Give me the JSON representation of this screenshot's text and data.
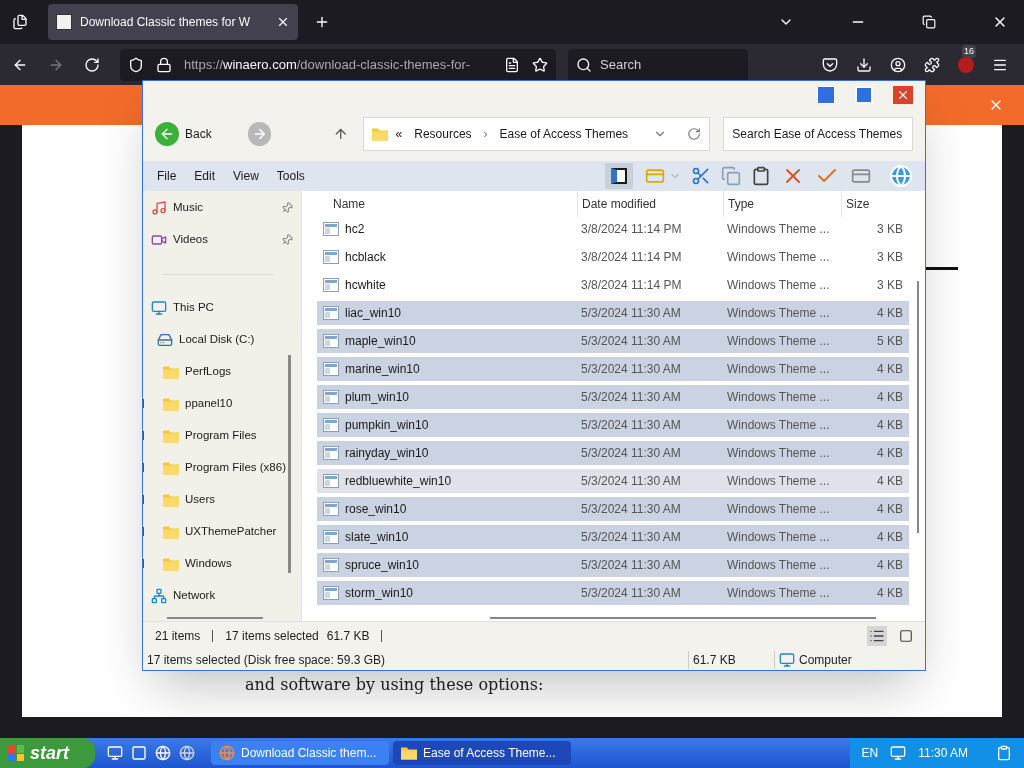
{
  "browser": {
    "tabs": [
      {
        "title": "Download Classic themes for W",
        "selected": true
      }
    ],
    "url_scheme": "https://",
    "url_host": "winaero.com",
    "url_path": "/download-classic-themes-for-",
    "search_placeholder": "Search",
    "extension_badge": "16"
  },
  "page": {
    "text": "and software by using these options:"
  },
  "explorer": {
    "back_label": "Back",
    "address_prefix": "«",
    "breadcrumbs": [
      "Resources",
      "Ease of Access Themes"
    ],
    "breadcrumb_separator": "›",
    "search_placeholder": "Search Ease of Access Themes",
    "menu": [
      "File",
      "Edit",
      "View",
      "Tools"
    ],
    "sidebar": [
      {
        "kind": "music",
        "label": "Music",
        "pinned": true
      },
      {
        "kind": "videos",
        "label": "Videos",
        "pinned": true
      },
      {
        "kind": "separator"
      },
      {
        "kind": "pc",
        "label": "This PC",
        "children": [
          {
            "kind": "disk",
            "label": "Local Disk (C:)",
            "children": [
              {
                "kind": "folder",
                "label": "PerfLogs",
                "expandable": false
              },
              {
                "kind": "folder",
                "label": "ppanel10",
                "expandable": true
              },
              {
                "kind": "folder",
                "label": "Program Files",
                "expandable": true
              },
              {
                "kind": "folder",
                "label": "Program Files (x86)",
                "expandable": true
              },
              {
                "kind": "folder",
                "label": "Users",
                "expandable": true
              },
              {
                "kind": "folder",
                "label": "UXThemePatcher",
                "expandable": true
              },
              {
                "kind": "folder",
                "label": "Windows",
                "expandable": true
              }
            ]
          }
        ]
      },
      {
        "kind": "network",
        "label": "Network"
      }
    ],
    "columns": [
      "Name",
      "Date modified",
      "Type",
      "Size"
    ],
    "rows": [
      {
        "name": "hc2",
        "date": "3/8/2024 11:14 PM",
        "type": "Windows Theme ...",
        "size": "3 KB",
        "selected": false,
        "hovered": false
      },
      {
        "name": "hcblack",
        "date": "3/8/2024 11:14 PM",
        "type": "Windows Theme ...",
        "size": "3 KB",
        "selected": false,
        "hovered": false
      },
      {
        "name": "hcwhite",
        "date": "3/8/2024 11:14 PM",
        "type": "Windows Theme ...",
        "size": "3 KB",
        "selected": false,
        "hovered": false
      },
      {
        "name": "liac_win10",
        "date": "5/3/2024 11:30 AM",
        "type": "Windows Theme ...",
        "size": "4 KB",
        "selected": true,
        "hovered": false
      },
      {
        "name": "maple_win10",
        "date": "5/3/2024 11:30 AM",
        "type": "Windows Theme ...",
        "size": "5 KB",
        "selected": true,
        "hovered": false
      },
      {
        "name": "marine_win10",
        "date": "5/3/2024 11:30 AM",
        "type": "Windows Theme ...",
        "size": "4 KB",
        "selected": true,
        "hovered": false
      },
      {
        "name": "plum_win10",
        "date": "5/3/2024 11:30 AM",
        "type": "Windows Theme ...",
        "size": "4 KB",
        "selected": true,
        "hovered": false
      },
      {
        "name": "pumpkin_win10",
        "date": "5/3/2024 11:30 AM",
        "type": "Windows Theme ...",
        "size": "4 KB",
        "selected": true,
        "hovered": false
      },
      {
        "name": "rainyday_win10",
        "date": "5/3/2024 11:30 AM",
        "type": "Windows Theme ...",
        "size": "4 KB",
        "selected": true,
        "hovered": false
      },
      {
        "name": "redbluewhite_win10",
        "date": "5/3/2024 11:30 AM",
        "type": "Windows Theme ...",
        "size": "4 KB",
        "selected": true,
        "hovered": true
      },
      {
        "name": "rose_win10",
        "date": "5/3/2024 11:30 AM",
        "type": "Windows Theme ...",
        "size": "4 KB",
        "selected": true,
        "hovered": false
      },
      {
        "name": "slate_win10",
        "date": "5/3/2024 11:30 AM",
        "type": "Windows Theme ...",
        "size": "4 KB",
        "selected": true,
        "hovered": false
      },
      {
        "name": "spruce_win10",
        "date": "5/3/2024 11:30 AM",
        "type": "Windows Theme ...",
        "size": "4 KB",
        "selected": true,
        "hovered": false
      },
      {
        "name": "storm_win10",
        "date": "5/3/2024 11:30 AM",
        "type": "Windows Theme ...",
        "size": "4 KB",
        "selected": true,
        "hovered": false
      }
    ],
    "status": {
      "count": "21 items",
      "selected": "17 items selected",
      "selected_size": "61.7 KB",
      "details": "17 items selected (Disk free space: 59.3 GB)",
      "size": "61.7 KB",
      "location": "Computer"
    }
  },
  "taskbar": {
    "start": "start",
    "tasks": [
      {
        "kind": "browser",
        "title": "Download Classic them...",
        "selected": false
      },
      {
        "kind": "folder",
        "title": "Ease of Access Theme...",
        "selected": true
      }
    ],
    "language": "EN",
    "time": "11:30 AM"
  }
}
